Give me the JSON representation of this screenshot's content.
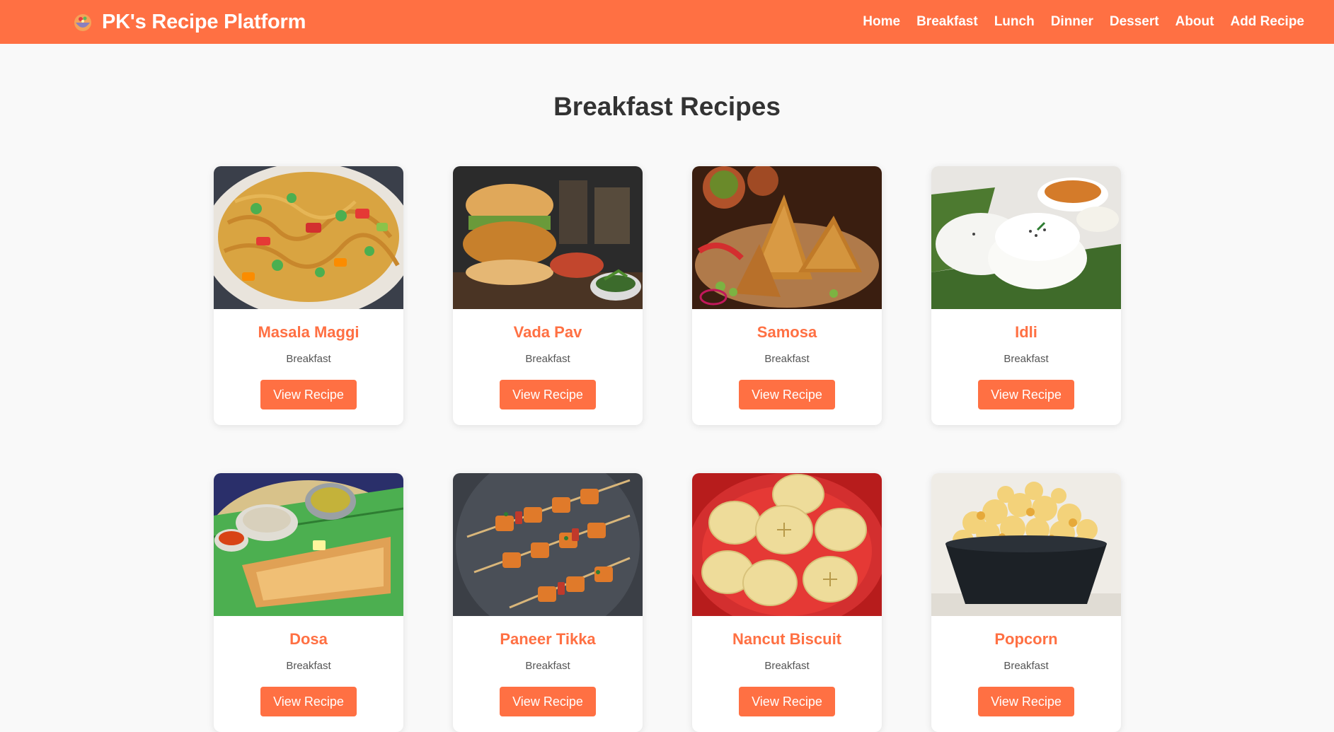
{
  "brand": {
    "title": "PK's Recipe Platform",
    "logo_icon": "recipe-bowl-icon"
  },
  "nav": {
    "items": [
      {
        "label": "Home"
      },
      {
        "label": "Breakfast"
      },
      {
        "label": "Lunch"
      },
      {
        "label": "Dinner"
      },
      {
        "label": "Dessert"
      },
      {
        "label": "About"
      },
      {
        "label": "Add Recipe"
      }
    ]
  },
  "page": {
    "title": "Breakfast Recipes"
  },
  "recipes": [
    {
      "name": "Masala Maggi",
      "category": "Breakfast",
      "button": "View Recipe"
    },
    {
      "name": "Vada Pav",
      "category": "Breakfast",
      "button": "View Recipe"
    },
    {
      "name": "Samosa",
      "category": "Breakfast",
      "button": "View Recipe"
    },
    {
      "name": "Idli",
      "category": "Breakfast",
      "button": "View Recipe"
    },
    {
      "name": "Dosa",
      "category": "Breakfast",
      "button": "View Recipe"
    },
    {
      "name": "Paneer Tikka",
      "category": "Breakfast",
      "button": "View Recipe"
    },
    {
      "name": "Nancut Biscuit",
      "category": "Breakfast",
      "button": "View Recipe"
    },
    {
      "name": "Popcorn",
      "category": "Breakfast",
      "button": "View Recipe"
    }
  ],
  "colors": {
    "accent": "#ff7043",
    "background": "#f9f9f9",
    "heading": "#333333"
  }
}
